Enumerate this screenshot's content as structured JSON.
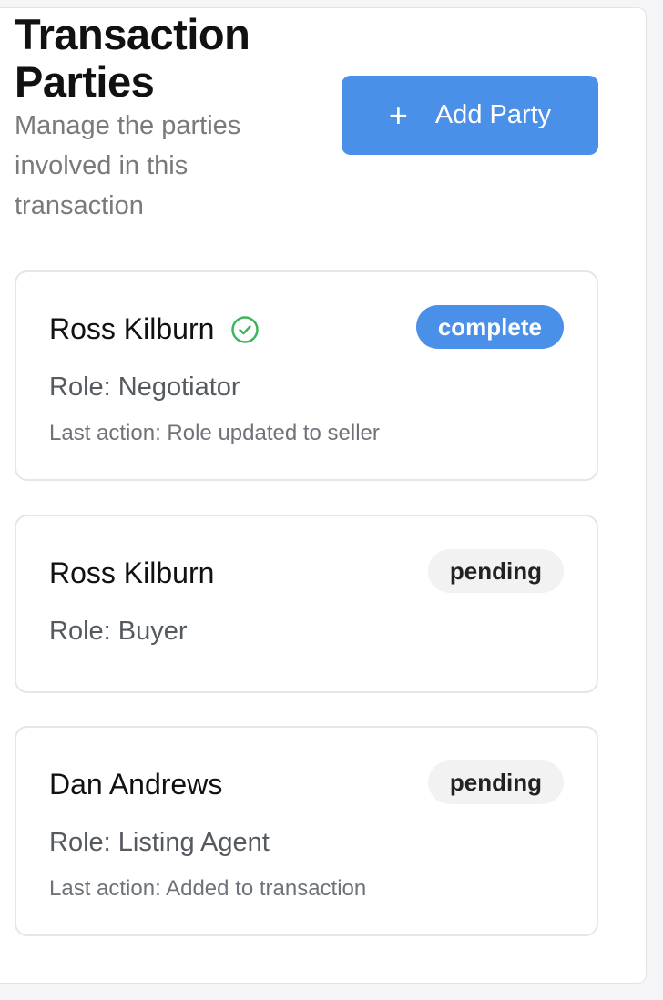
{
  "header": {
    "title": "Transaction Parties",
    "subtitle": "Manage the parties involved in this transaction",
    "add_button_icon": "+",
    "add_button_label": "Add Party"
  },
  "parties": [
    {
      "name": "Ross Kilburn",
      "verified": true,
      "status": "complete",
      "role": "Role: Negotiator",
      "last_action": "Last action: Role updated to seller"
    },
    {
      "name": "Ross Kilburn",
      "verified": false,
      "status": "pending",
      "role": "Role: Buyer",
      "last_action": ""
    },
    {
      "name": "Dan Andrews",
      "verified": false,
      "status": "pending",
      "role": "Role: Listing Agent",
      "last_action": "Last action: Added to transaction"
    }
  ],
  "colors": {
    "accent": "#4a90e8",
    "verified_green": "#3fb55b",
    "pending_badge_bg": "#f2f2f3"
  }
}
